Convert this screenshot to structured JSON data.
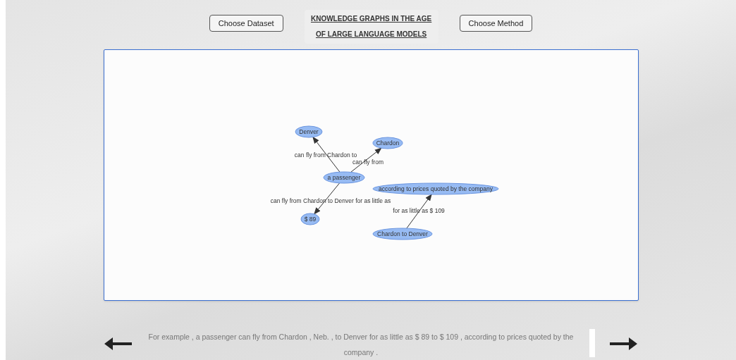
{
  "toolbar": {
    "dataset_button": "Choose Dataset",
    "title_line_1": "KNOWLEDGE GRAPHS IN THE AGE",
    "title_line_2": "OF LARGE LANGUAGE MODELS",
    "method_button": "Choose Method"
  },
  "graph": {
    "nodes": [
      {
        "label": "Denver"
      },
      {
        "label": "Chardon"
      },
      {
        "label": "a passenger"
      },
      {
        "label": "$ 89"
      },
      {
        "label": "according to prices quoted by the company"
      },
      {
        "label": "Chardon to Denver"
      }
    ],
    "edges": [
      {
        "label": "can fly from Chardon to"
      },
      {
        "label": "can fly from"
      },
      {
        "label": "can fly from Chardon to Denver for as little as"
      },
      {
        "label": "for as little as $ 109"
      }
    ]
  },
  "sentence": "For example , a passenger can fly from Chardon , Neb. , to Denver for as little as $ 89 to $ 109 , according to prices quoted by the company ."
}
